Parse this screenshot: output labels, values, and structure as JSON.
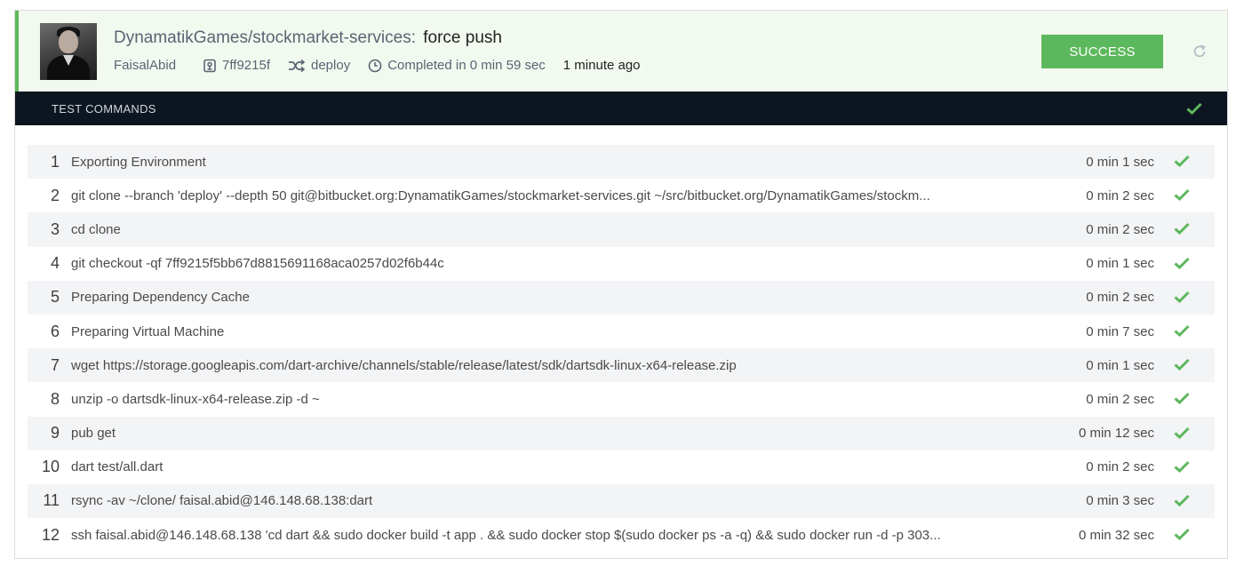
{
  "header": {
    "repo": "DynamatikGames/stockmarket-services:",
    "commit_message": "force push",
    "author": "FaisalAbid",
    "commit_hash": "7ff9215f",
    "branch": "deploy",
    "duration": "Completed in 0 min 59 sec",
    "time_ago": "1 minute ago",
    "status_label": "SUCCESS",
    "status_color": "#5cb85c",
    "icons": [
      "commit-icon",
      "branch-icon",
      "clock-icon",
      "refresh-icon"
    ]
  },
  "section": {
    "title": "TEST COMMANDS",
    "status_icon": "check-icon"
  },
  "commands": [
    {
      "num": "1",
      "text": "Exporting Environment",
      "duration": "0 min 1 sec"
    },
    {
      "num": "2",
      "text": "git clone --branch 'deploy' --depth 50 git@bitbucket.org:DynamatikGames/stockmarket-services.git ~/src/bitbucket.org/DynamatikGames/stockm...",
      "duration": "0 min 2 sec"
    },
    {
      "num": "3",
      "text": "cd clone",
      "duration": "0 min 2 sec"
    },
    {
      "num": "4",
      "text": "git checkout -qf 7ff9215f5bb67d8815691168aca0257d02f6b44c",
      "duration": "0 min 1 sec"
    },
    {
      "num": "5",
      "text": "Preparing Dependency Cache",
      "duration": "0 min 2 sec"
    },
    {
      "num": "6",
      "text": "Preparing Virtual Machine",
      "duration": "0 min 7 sec"
    },
    {
      "num": "7",
      "text": "wget https://storage.googleapis.com/dart-archive/channels/stable/release/latest/sdk/dartsdk-linux-x64-release.zip",
      "duration": "0 min 1 sec"
    },
    {
      "num": "8",
      "text": "unzip -o dartsdk-linux-x64-release.zip -d ~",
      "duration": "0 min 2 sec"
    },
    {
      "num": "9",
      "text": "pub get",
      "duration": "0 min 12 sec"
    },
    {
      "num": "10",
      "text": "dart test/all.dart",
      "duration": "0 min 2 sec"
    },
    {
      "num": "11",
      "text": "rsync -av ~/clone/ faisal.abid@146.148.68.138:dart",
      "duration": "0 min 3 sec"
    },
    {
      "num": "12",
      "text": "ssh faisal.abid@146.148.68.138 'cd dart && sudo docker build -t app . && sudo docker stop $(sudo docker ps -a -q) && sudo docker run -d -p 303...",
      "duration": "0 min 32 sec"
    }
  ]
}
